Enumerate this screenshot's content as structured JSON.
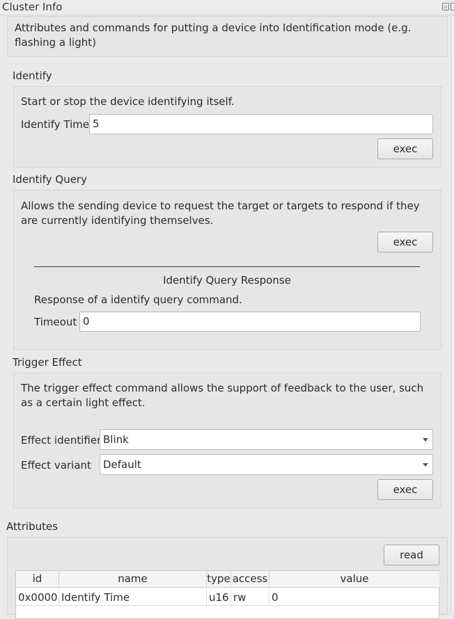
{
  "window": {
    "title": "Cluster Info"
  },
  "cluster": {
    "description": "Attributes and commands for putting a device into Identification mode (e.g. flashing a light)"
  },
  "identify": {
    "title": "Identify",
    "description": "Start or stop the device identifying itself.",
    "field_label": "Identify Time",
    "field_value": "5",
    "exec_label": "exec"
  },
  "identify_query": {
    "title": "Identify Query",
    "description": "Allows the sending device to request the target or targets to respond if they are currently identifying themselves.",
    "exec_label": "exec",
    "response": {
      "title": "Identify Query Response",
      "description": "Response of a identify query command.",
      "field_label": "Timeout",
      "field_value": "0"
    }
  },
  "trigger_effect": {
    "title": "Trigger Effect",
    "description": "The trigger effect command allows the support of feedback to the user, such as a certain light effect.",
    "effect_identifier_label": "Effect identifier",
    "effect_identifier_value": "Blink",
    "effect_variant_label": "Effect variant",
    "effect_variant_value": "Default",
    "exec_label": "exec"
  },
  "attributes": {
    "title": "Attributes",
    "read_label": "read",
    "columns": [
      "id",
      "name",
      "type",
      "access",
      "value"
    ],
    "rows": [
      {
        "id": "0x0000",
        "name": "Identify Time",
        "type": "u16",
        "access": "rw",
        "value": "0"
      }
    ]
  }
}
